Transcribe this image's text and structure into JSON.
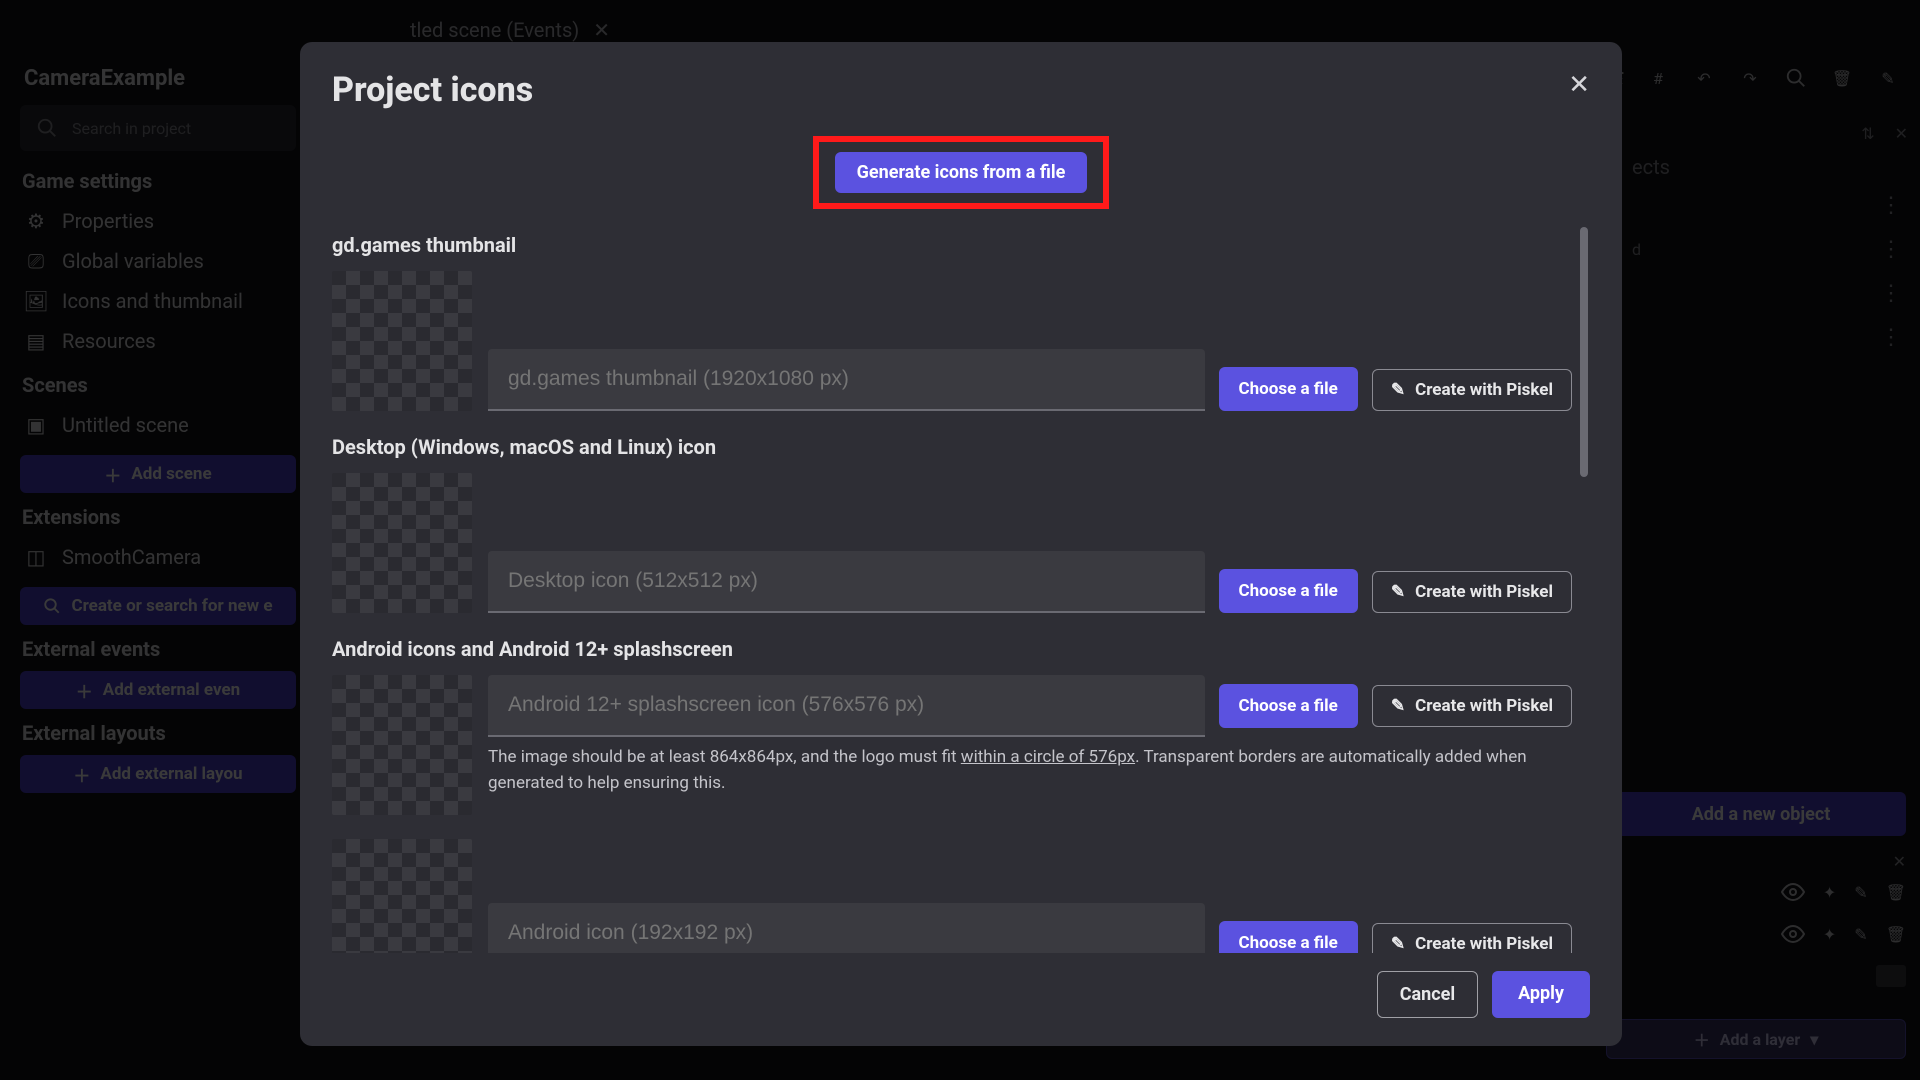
{
  "project_title": "CameraExample",
  "search_placeholder": "Search in project",
  "tab": {
    "label": "tled scene (Events)"
  },
  "sidebar": {
    "game_settings_label": "Game settings",
    "properties": "Properties",
    "global_vars": "Global variables",
    "icons_thumb": "Icons and thumbnail",
    "resources": "Resources",
    "scenes_label": "Scenes",
    "scene1": "Untitled scene",
    "add_scene": "Add scene",
    "extensions_label": "Extensions",
    "ext1": "SmoothCamera",
    "create_ext": "Create or search for new e",
    "ext_events_label": "External events",
    "add_ext_events": "Add external even",
    "ext_layouts_label": "External layouts",
    "add_ext_layout": "Add external layou"
  },
  "right": {
    "objects_hint": "ects",
    "item1_hint": "d",
    "add_object": "Add a new object",
    "add_layer": "Add a layer"
  },
  "modal": {
    "title": "Project icons",
    "generate": "Generate icons from a file",
    "sections": {
      "gd_thumb": "gd.games thumbnail",
      "desktop": "Desktop (Windows, macOS and Linux) icon",
      "android": "Android icons and Android 12+ splashscreen"
    },
    "fields": {
      "gd_thumb": "gd.games thumbnail (1920x1080 px)",
      "desktop": "Desktop icon (512x512 px)",
      "android_splash": "Android 12+ splashscreen icon (576x576 px)",
      "android_icon": "Android icon (192x192 px)"
    },
    "helper": {
      "pre": "The image should be at least 864x864px, and the logo must fit ",
      "link": "within a circle of 576px",
      "post": ". Transparent borders are automatically added when generated to help ensuring this."
    },
    "choose": "Choose a file",
    "piskel": "Create with Piskel",
    "cancel": "Cancel",
    "apply": "Apply"
  }
}
